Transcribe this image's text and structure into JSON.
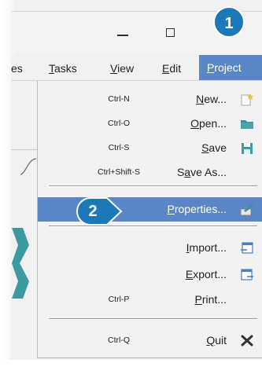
{
  "menubar": {
    "items": [
      {
        "label": "es",
        "underline": ""
      },
      {
        "label": "Tasks",
        "underline": "T"
      },
      {
        "label": "View",
        "underline": "V"
      },
      {
        "label": "Edit",
        "underline": "E"
      },
      {
        "label": "Project",
        "underline": "P"
      }
    ],
    "active": "Project"
  },
  "menu": {
    "rows": [
      {
        "shortcut": "Ctrl-N",
        "label": "New...",
        "icon": "new-project-icon"
      },
      {
        "shortcut": "Ctrl-O",
        "label": "Open...",
        "icon": "open-folder-icon"
      },
      {
        "shortcut": "Ctrl-S",
        "label": "Save",
        "icon": "save-icon"
      },
      {
        "shortcut": "Ctrl+Shift-S",
        "label": "Save As...",
        "icon": ""
      },
      {
        "shortcut": "",
        "label": "Properties...",
        "icon": "properties-icon",
        "highlighted": true
      },
      {
        "shortcut": "",
        "label": "Import...",
        "icon": "import-icon"
      },
      {
        "shortcut": "",
        "label": "Export...",
        "icon": "export-icon"
      },
      {
        "shortcut": "Ctrl-P",
        "label": "Print...",
        "icon": ""
      },
      {
        "shortcut": "Ctrl-Q",
        "label": "Quit",
        "icon": "quit-icon"
      }
    ]
  },
  "badges": {
    "step1": "1",
    "step2": "2"
  },
  "colors": {
    "accent": "#5a86c6",
    "badge": "#1d78b9"
  }
}
